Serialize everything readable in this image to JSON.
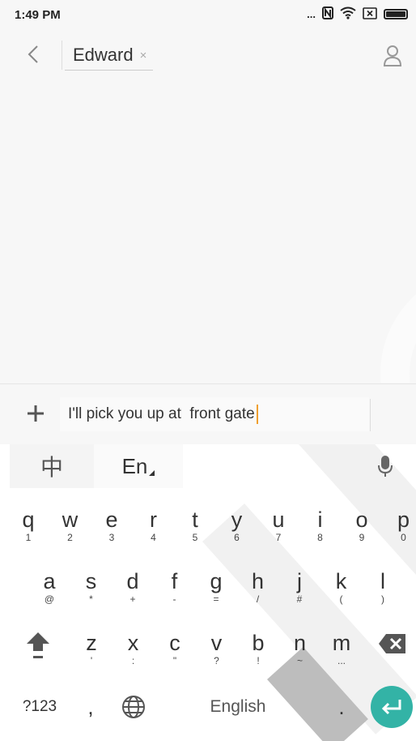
{
  "status_bar": {
    "time": "1:49 PM",
    "dots": "..."
  },
  "header": {
    "recipient_name": "Edward",
    "remove_glyph": "×"
  },
  "composer": {
    "message_text": "I'll pick you up at  front gate"
  },
  "keyboard": {
    "toolbar": {
      "chinese_label": "中",
      "english_label": "En"
    },
    "row1": [
      {
        "main": "q",
        "sub": "1"
      },
      {
        "main": "w",
        "sub": "2"
      },
      {
        "main": "e",
        "sub": "3"
      },
      {
        "main": "r",
        "sub": "4"
      },
      {
        "main": "t",
        "sub": "5"
      },
      {
        "main": "y",
        "sub": "6"
      },
      {
        "main": "u",
        "sub": "7"
      },
      {
        "main": "i",
        "sub": "8"
      },
      {
        "main": "o",
        "sub": "9"
      },
      {
        "main": "p",
        "sub": "0"
      }
    ],
    "row2": [
      {
        "main": "a",
        "sub": "@"
      },
      {
        "main": "s",
        "sub": "*"
      },
      {
        "main": "d",
        "sub": "+"
      },
      {
        "main": "f",
        "sub": "-"
      },
      {
        "main": "g",
        "sub": "="
      },
      {
        "main": "h",
        "sub": "/"
      },
      {
        "main": "j",
        "sub": "#"
      },
      {
        "main": "k",
        "sub": "("
      },
      {
        "main": "l",
        "sub": ")"
      }
    ],
    "row3": [
      {
        "main": "z",
        "sub": "'"
      },
      {
        "main": "x",
        "sub": ":"
      },
      {
        "main": "c",
        "sub": "\""
      },
      {
        "main": "v",
        "sub": "?"
      },
      {
        "main": "b",
        "sub": "!"
      },
      {
        "main": "n",
        "sub": "~"
      },
      {
        "main": "m",
        "sub": "..."
      }
    ],
    "bottom": {
      "symbols_label": "?123",
      "comma_label": ",",
      "space_label": "English",
      "period_label": "."
    }
  },
  "colors": {
    "accent": "#33b3a6",
    "caret": "#f0a030",
    "background": "#f7f7f7"
  },
  "icons": [
    "back-arrow-icon",
    "contact-icon",
    "add-icon",
    "mic-icon",
    "shift-icon",
    "backspace-icon",
    "globe-icon",
    "enter-icon",
    "nfc-icon",
    "wifi-icon",
    "sim-icon",
    "battery-icon"
  ]
}
